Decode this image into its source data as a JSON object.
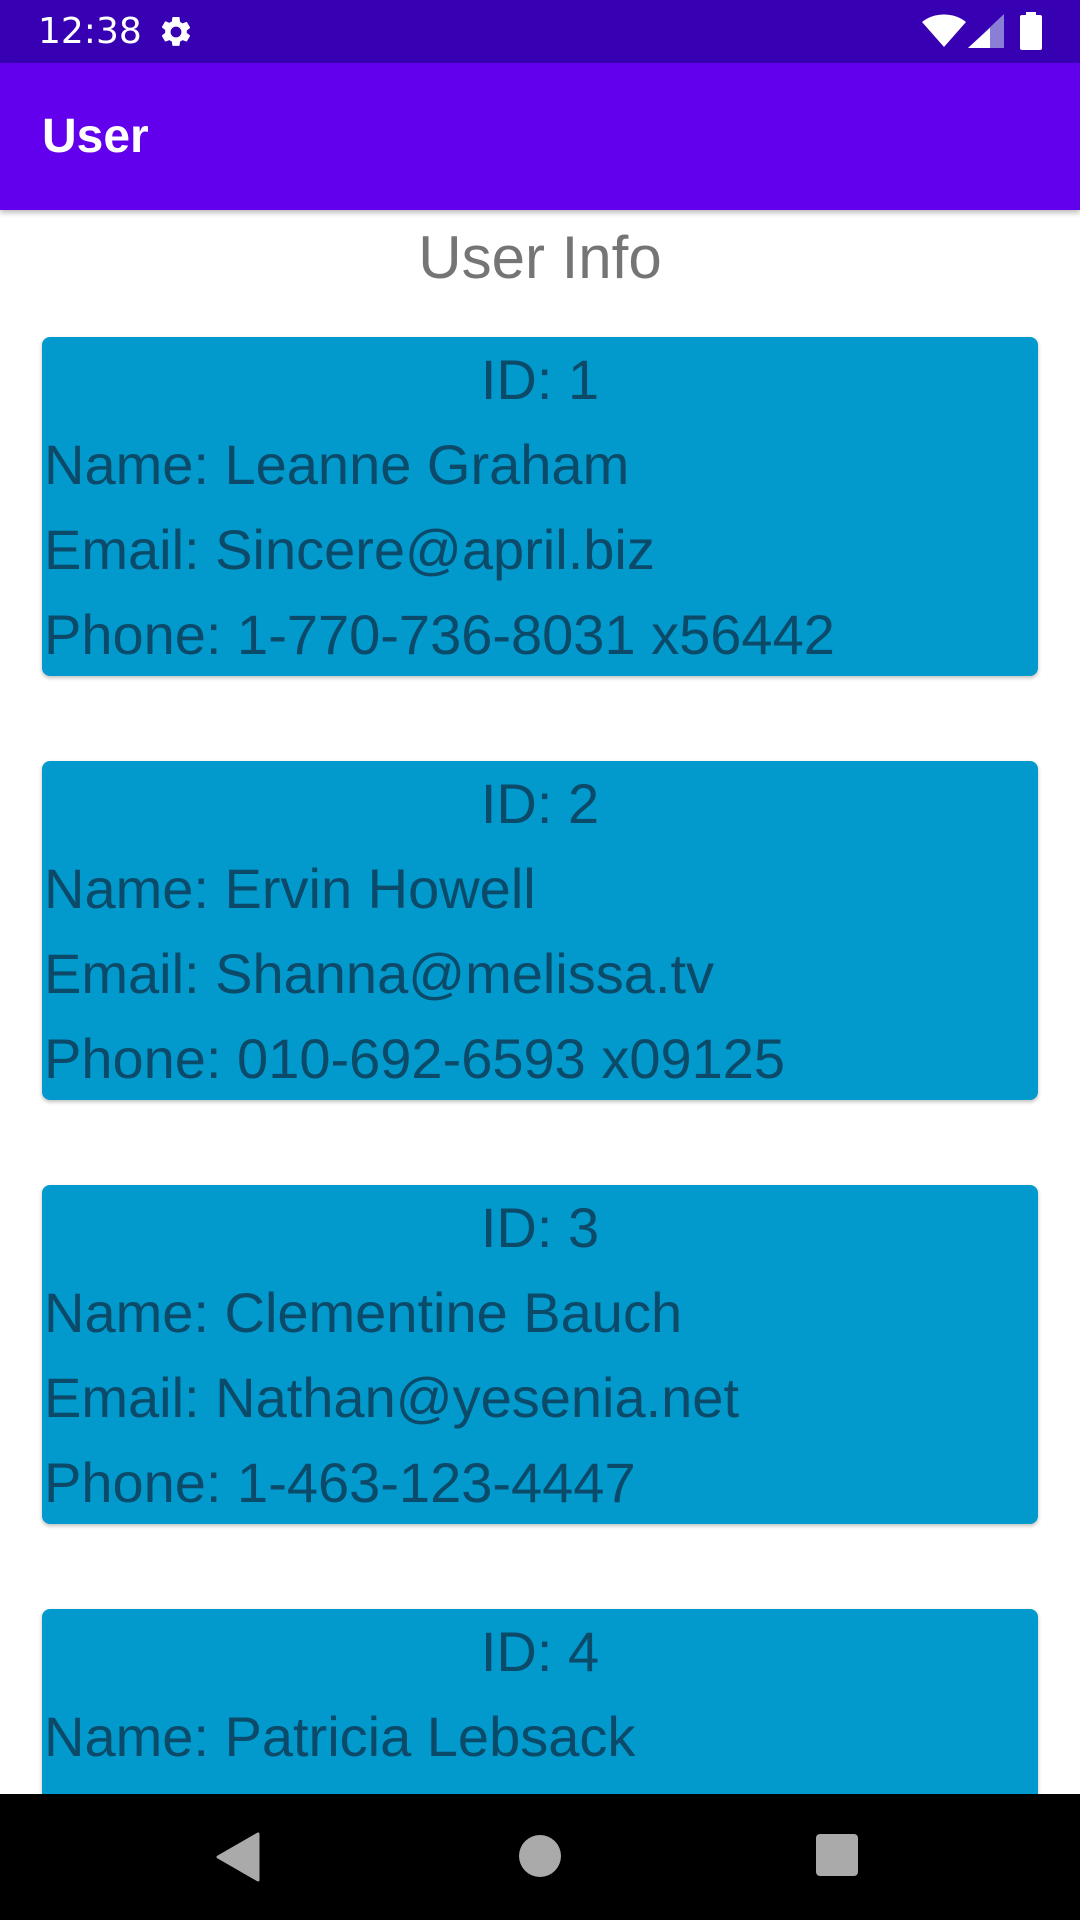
{
  "status_bar": {
    "time": "12:38",
    "icons": [
      "gear-icon",
      "wifi-icon",
      "signal-icon",
      "battery-icon"
    ]
  },
  "app_bar": {
    "title": "User"
  },
  "main": {
    "section_title": "User Info",
    "users": [
      {
        "id_line": "ID: 1",
        "name_line": "Name: Leanne Graham",
        "email_line": "Email: Sincere@april.biz",
        "phone_line": "Phone: 1-770-736-8031 x56442"
      },
      {
        "id_line": "ID: 2",
        "name_line": "Name: Ervin Howell",
        "email_line": "Email: Shanna@melissa.tv",
        "phone_line": "Phone: 010-692-6593 x09125"
      },
      {
        "id_line": "ID: 3",
        "name_line": "Name: Clementine Bauch",
        "email_line": "Email: Nathan@yesenia.net",
        "phone_line": "Phone: 1-463-123-4447"
      },
      {
        "id_line": "ID: 4",
        "name_line": "Name: Patricia Lebsack",
        "email_line": "",
        "phone_line": ""
      }
    ]
  },
  "nav_bar": {
    "icons": [
      "back-icon",
      "home-icon",
      "recents-icon"
    ]
  },
  "colors": {
    "status_bar": "#3700b3",
    "app_bar": "#6200ee",
    "card_background": "#0299cc",
    "card_text": "#0b4a69",
    "section_title": "#757575"
  }
}
